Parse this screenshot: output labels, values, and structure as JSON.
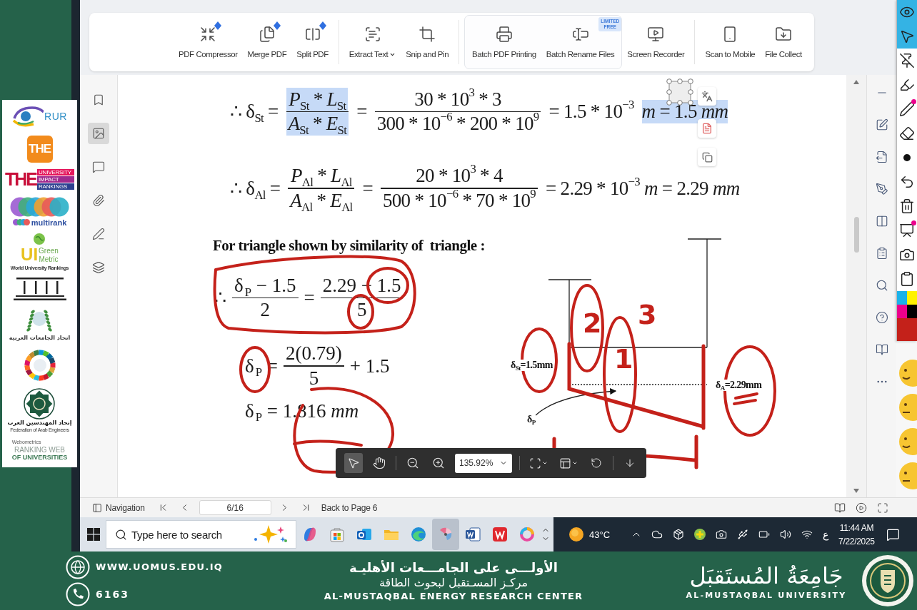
{
  "toolbar": {
    "groups": [
      {
        "kind": "plain",
        "tools": [
          {
            "kind": "compress",
            "label": "PDF Compressor",
            "new": true,
            "menu": false
          },
          {
            "kind": "merge",
            "label": "Merge PDF",
            "new": true,
            "menu": false
          },
          {
            "kind": "split",
            "label": "Split PDF",
            "new": true,
            "menu": false
          }
        ]
      },
      {
        "kind": "plain",
        "tools": [
          {
            "kind": "extract",
            "label": "Extract Text",
            "new": false,
            "menu": true
          },
          {
            "kind": "snip",
            "label": "Snip and Pin",
            "new": false,
            "menu": false
          }
        ]
      },
      {
        "kind": "boxed",
        "tools": [
          {
            "kind": "print",
            "label": "Batch PDF Printing",
            "new": false,
            "menu": false
          },
          {
            "kind": "rename",
            "label": "Batch Rename Files",
            "new": false,
            "menu": false,
            "badge": "LIMITED FREE"
          }
        ]
      },
      {
        "kind": "plain",
        "tools": [
          {
            "kind": "record",
            "label": "Screen Recorder",
            "new": false,
            "menu": false
          }
        ]
      },
      {
        "kind": "plain",
        "tools": [
          {
            "kind": "scan",
            "label": "Scan to Mobile",
            "new": false,
            "menu": false
          },
          {
            "kind": "collect",
            "label": "File Collect",
            "new": false,
            "menu": false
          }
        ]
      }
    ]
  },
  "sidebar": {
    "items": [
      {
        "kind": "bookmarks",
        "selected": false
      },
      {
        "kind": "thumbnails",
        "selected": true
      },
      {
        "kind": "comments",
        "selected": false
      },
      {
        "kind": "attachments",
        "selected": false
      },
      {
        "kind": "signatures",
        "selected": false
      },
      {
        "kind": "layers",
        "selected": false
      }
    ]
  },
  "document": {
    "equations": [
      [
        {
          "kind": "text",
          "runs": [
            {
              "text": "∴ δ"
            },
            {
              "sub": "St"
            },
            {
              "text": " ="
            }
          ],
          "selected": false
        },
        {
          "kind": "fraction",
          "numerator": [
            {
              "em": "P"
            },
            {
              "sub": "St"
            },
            {
              "text": " * "
            },
            {
              "em": "L"
            },
            {
              "sub": "St"
            }
          ],
          "denominator": [
            {
              "em": "A"
            },
            {
              "sub": "St"
            },
            {
              "text": " * "
            },
            {
              "em": "E"
            },
            {
              "sub": "St"
            }
          ],
          "selected": true
        },
        {
          "kind": "text",
          "runs": [
            {
              "text": "="
            }
          ],
          "selected": false
        },
        {
          "kind": "fraction",
          "numerator": [
            {
              "text": "30 * 10"
            },
            {
              "sup": "3"
            },
            {
              "text": " * 3"
            }
          ],
          "denominator": [
            {
              "text": "300 * 10"
            },
            {
              "sup": "−6"
            },
            {
              "text": " * 200 * 10"
            },
            {
              "sup": "9"
            }
          ],
          "selected": false
        },
        {
          "kind": "text",
          "runs": [
            {
              "text": "= 1.5 * 10"
            },
            {
              "sup": "−3"
            }
          ],
          "selected": false
        },
        {
          "kind": "text",
          "runs": [
            {
              "em": "m"
            },
            {
              "text": " = 1.5 "
            },
            {
              "em": "mm"
            }
          ],
          "selected": true
        }
      ],
      [
        {
          "kind": "text",
          "runs": [
            {
              "text": "∴ δ"
            },
            {
              "sub": "Al"
            },
            {
              "text": " ="
            }
          ],
          "selected": false
        },
        {
          "kind": "fraction",
          "numerator": [
            {
              "em": "P"
            },
            {
              "sub": "Al"
            },
            {
              "text": " * "
            },
            {
              "em": "L"
            },
            {
              "sub": "Al"
            }
          ],
          "denominator": [
            {
              "em": "A"
            },
            {
              "sub": "Al"
            },
            {
              "text": " * "
            },
            {
              "em": "E"
            },
            {
              "sub": "Al"
            }
          ],
          "selected": false
        },
        {
          "kind": "text",
          "runs": [
            {
              "text": "="
            }
          ],
          "selected": false
        },
        {
          "kind": "fraction",
          "numerator": [
            {
              "text": "20 * 10"
            },
            {
              "sup": "3"
            },
            {
              "text": " * 4"
            }
          ],
          "denominator": [
            {
              "text": "500 * 10"
            },
            {
              "sup": "−6"
            },
            {
              "text": " * 70 * 10"
            },
            {
              "sup": "9"
            }
          ],
          "selected": false
        },
        {
          "kind": "text",
          "runs": [
            {
              "text": "= 2.29 * 10"
            },
            {
              "sup": "−3"
            },
            {
              "em": " m"
            },
            {
              "text": " = 2.29 "
            },
            {
              "em": "mm"
            }
          ],
          "selected": false
        }
      ]
    ],
    "section": {
      "heading": "For triangle shown by similarity of  triangle :",
      "equations": [
        [
          {
            "kind": "text",
            "runs": [
              {
                "text": "∴"
              }
            ],
            "selected": false
          },
          {
            "kind": "fraction",
            "numerator": [
              {
                "text": "δ"
              },
              {
                "sub": "P"
              },
              {
                "text": " − 1.5"
              }
            ],
            "denominator": [
              {
                "text": "2"
              }
            ],
            "selected": false
          },
          {
            "kind": "text",
            "runs": [
              {
                "text": "="
              }
            ],
            "selected": false
          },
          {
            "kind": "fraction",
            "numerator": [
              {
                "text": "2.29 − 1.5"
              }
            ],
            "denominator": [
              {
                "text": "5"
              }
            ],
            "selected": false
          }
        ],
        [
          {
            "kind": "text",
            "runs": [
              {
                "text": "δ"
              },
              {
                "sub": "P"
              },
              {
                "text": " ="
              }
            ],
            "selected": false
          },
          {
            "kind": "fraction",
            "numerator": [
              {
                "text": "2(0.79)"
              }
            ],
            "denominator": [
              {
                "text": "5"
              }
            ],
            "selected": false
          },
          {
            "kind": "text",
            "runs": [
              {
                "text": "+ 1.5"
              }
            ],
            "selected": false
          }
        ],
        [
          {
            "kind": "text",
            "runs": [
              {
                "text": "δ"
              },
              {
                "sub": "P"
              },
              {
                "text": " = 1.816 "
              },
              {
                "em": "mm"
              }
            ],
            "selected": false
          }
        ]
      ],
      "diagram": {
        "labels": [
          [
            {
              "text": "δ"
            },
            {
              "sub": "St"
            },
            {
              "text": "=1.5mm"
            }
          ],
          [
            {
              "text": "δ"
            },
            {
              "sub": "A"
            },
            {
              "text": "=2.29mm"
            }
          ],
          [
            {
              "text": "δ"
            },
            {
              "sub": "P"
            }
          ]
        ],
        "ink_labels": [
          "2",
          "3",
          "1"
        ]
      }
    }
  },
  "zoom_bar": {
    "tools": [
      {
        "kind": "select",
        "selected": true
      },
      {
        "kind": "hand",
        "selected": false
      }
    ],
    "zoom": "135.92%"
  },
  "status_bar": {
    "navigation": "Navigation",
    "page": "6/16",
    "back_link": "Back to Page 6"
  },
  "annotation_bar": {
    "tools": [
      {
        "kind": "eye",
        "selected": true
      },
      {
        "kind": "pointer",
        "selected": true
      },
      {
        "kind": "pin",
        "selected": false
      },
      {
        "kind": "highlighter",
        "selected": false
      },
      {
        "kind": "pen",
        "selected": false
      },
      {
        "kind": "eraser",
        "selected": false
      },
      {
        "kind": "dot",
        "selected": false
      },
      {
        "kind": "undo",
        "selected": false
      },
      {
        "kind": "trash",
        "selected": false
      },
      {
        "kind": "board",
        "selected": false
      },
      {
        "kind": "camera",
        "selected": false
      },
      {
        "kind": "clipboard",
        "selected": false
      }
    ],
    "palette": [
      {
        "color": "#1ab2ea",
        "selected": false
      },
      {
        "color": "#fff200",
        "selected": false
      },
      {
        "color": "#ec008c",
        "selected": false
      },
      {
        "color": "#000000",
        "selected": false
      },
      {
        "color": "#c4211a",
        "selected": true
      }
    ]
  },
  "taskbar": {
    "search": {
      "placeholder": "Type here to search"
    },
    "apps": [
      {
        "kind": "swirl",
        "selected": false
      },
      {
        "kind": "bag",
        "selected": false
      },
      {
        "kind": "mail",
        "selected": false
      },
      {
        "kind": "folder",
        "selected": false
      },
      {
        "kind": "browser",
        "selected": false
      },
      {
        "kind": "fan",
        "selected": true
      },
      {
        "kind": "document",
        "selected": false
      },
      {
        "kind": "office",
        "selected": false
      },
      {
        "kind": "ring",
        "selected": false
      }
    ],
    "weather": "43°C",
    "language": "ع",
    "time": "11:44 AM",
    "date": "7/22/2025"
  },
  "logos": [
    {
      "kind": "rur",
      "text": "RUR"
    },
    {
      "kind": "tile",
      "text": "THE"
    },
    {
      "kind": "impact",
      "text": "THE",
      "lines": [
        "UNIVERSITY",
        "IMPACT",
        "RANKINGS"
      ]
    },
    {
      "kind": "multirank",
      "text": "multirank"
    },
    {
      "kind": "greenmetric",
      "text": "UI",
      "lines": [
        "Green",
        "Metric"
      ],
      "caption": "World University Rankings"
    },
    {
      "kind": "pillars"
    },
    {
      "kind": "wreath",
      "caption": "اتحاد الجامعات العربية"
    },
    {
      "kind": "wheel"
    },
    {
      "kind": "emblem",
      "caption": "إتحاد المهندسين العرب",
      "subcaption": "Federation of Arab Engineers"
    },
    {
      "kind": "webometrics",
      "caption": "Webometrics",
      "lines": [
        "RANKING WEB",
        "OF UNIVERSITIES"
      ]
    }
  ],
  "footer": {
    "website": "WWW.UOMUS.EDU.IQ",
    "phone": "6163",
    "headline": "الأولـــى على الجامـــعات الأهليـة",
    "center_name": "مركـز المسـتقبل لبحوث الطاقة",
    "center_name_en": "AL-MUSTAQBAL ENERGY RESEARCH CENTER",
    "university_ar": "جَامِعَةُ المُستَقبَل",
    "university_en": "AL-MUSTAQBAL UNIVERSITY"
  }
}
